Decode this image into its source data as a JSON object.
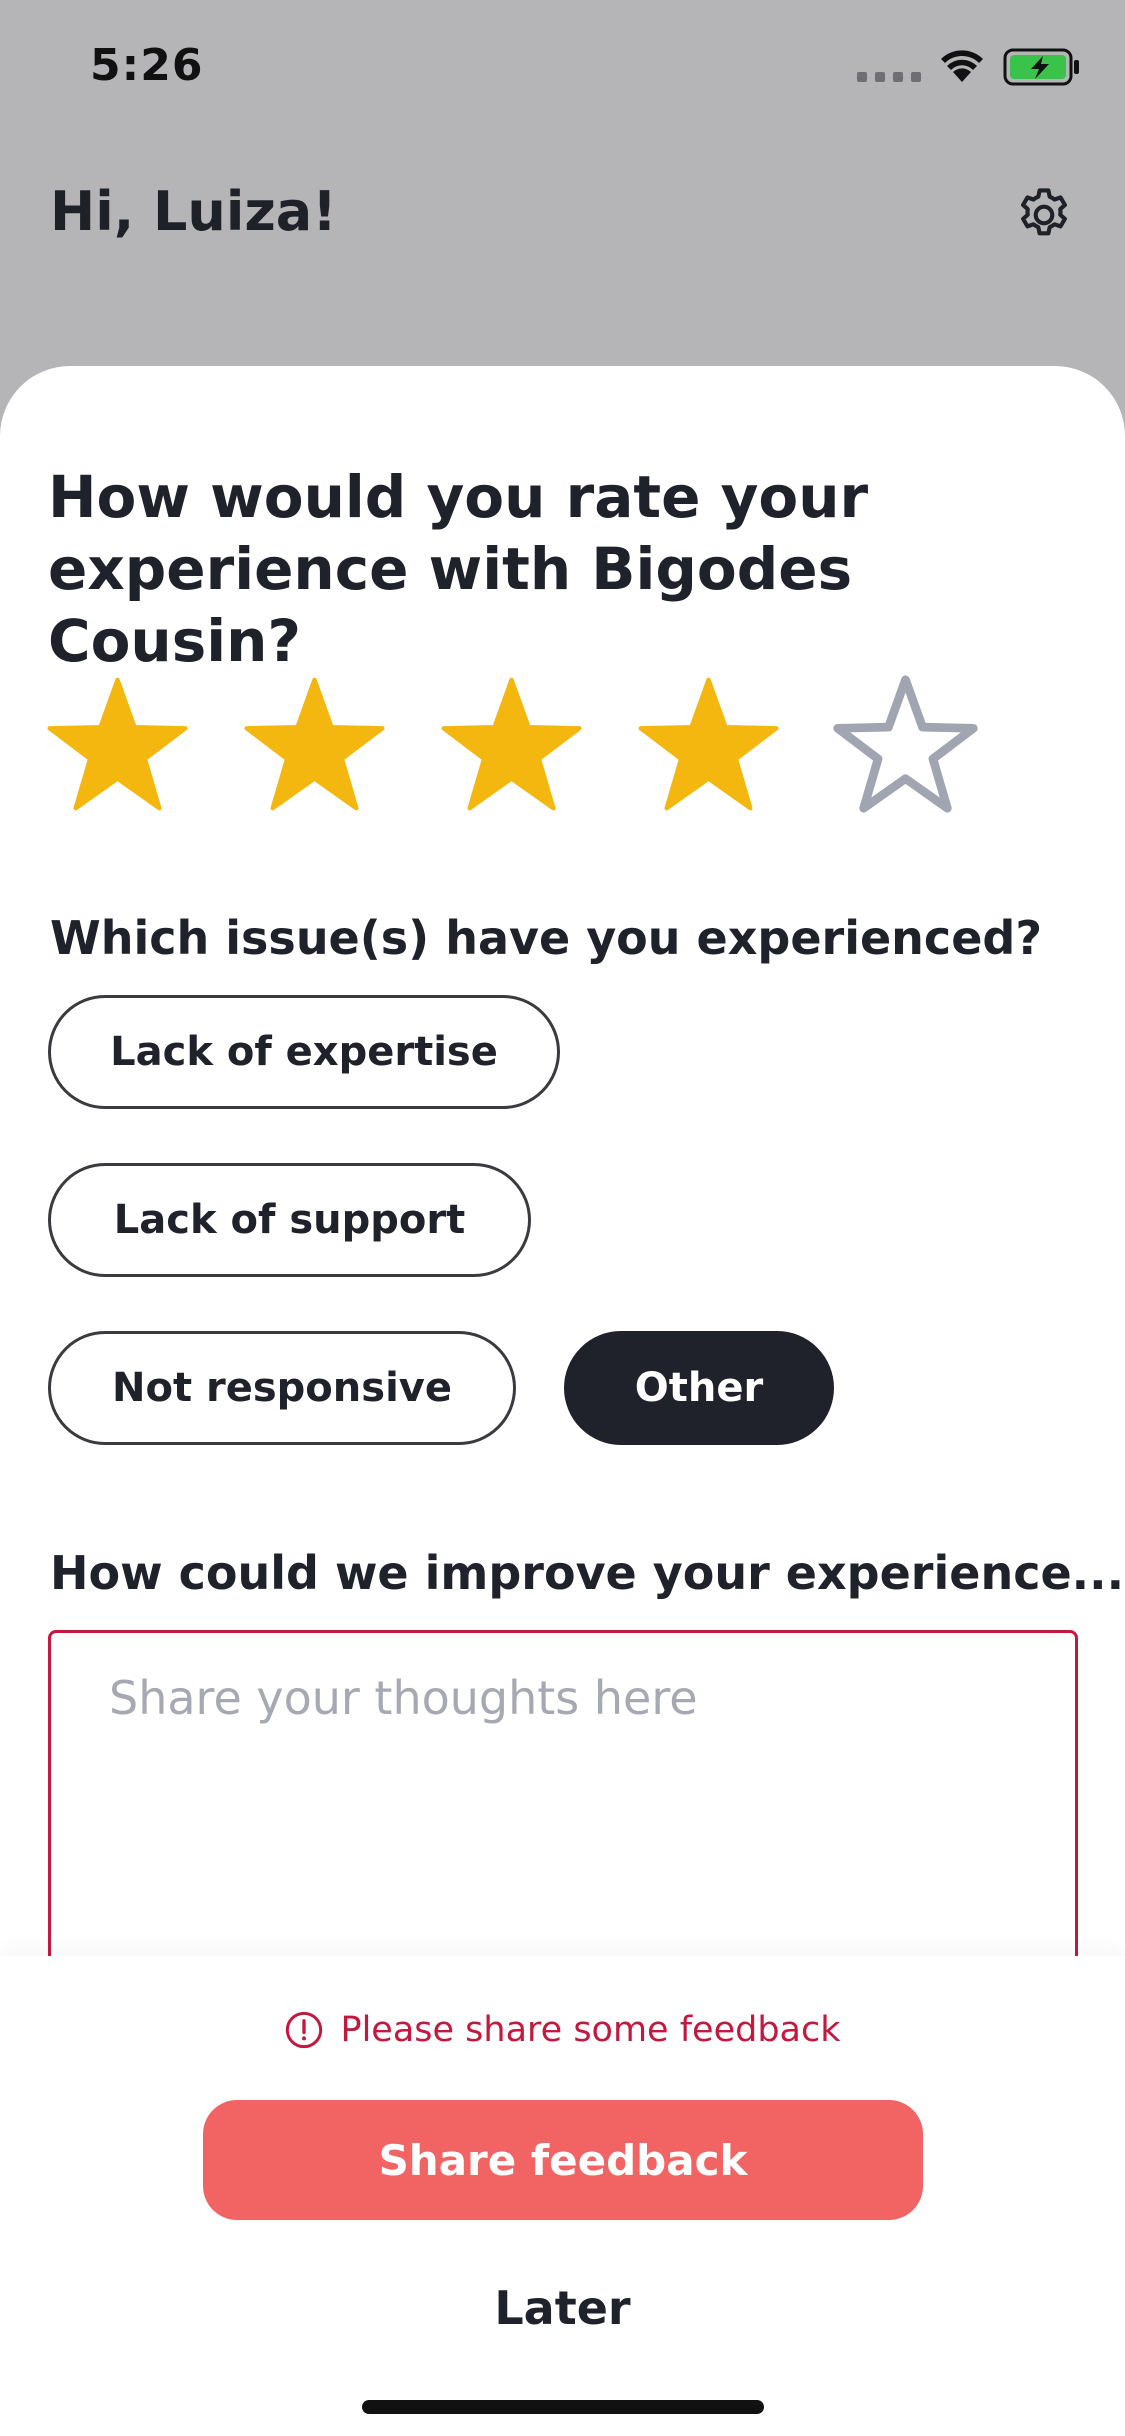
{
  "status_bar": {
    "time": "5:26",
    "icons": [
      "cellular-signal-icon",
      "wifi-icon",
      "battery-charging-icon"
    ]
  },
  "header": {
    "greeting": "Hi, Luiza!",
    "settings_icon": "gear-icon"
  },
  "rating": {
    "question": "How would you rate your experience with Bigodes Cousin?",
    "stars_total": 5,
    "stars_selected": 4,
    "filled_color": "#F4B70F",
    "empty_color": "#A0A5B1"
  },
  "issues": {
    "title": "Which issue(s) have you experienced?",
    "options": [
      {
        "label": "Lack of expertise",
        "selected": false
      },
      {
        "label": "Lack of support",
        "selected": false
      },
      {
        "label": "Not responsive",
        "selected": false
      },
      {
        "label": "Other",
        "selected": true
      }
    ]
  },
  "improve": {
    "title": "How could we improve your experience...",
    "placeholder": "Share your thoughts here",
    "value": ""
  },
  "footer": {
    "error_message": "Please share some feedback",
    "error_color": "#C4193F",
    "share_button": "Share feedback",
    "share_button_color": "#F26464",
    "later_button": "Later"
  }
}
